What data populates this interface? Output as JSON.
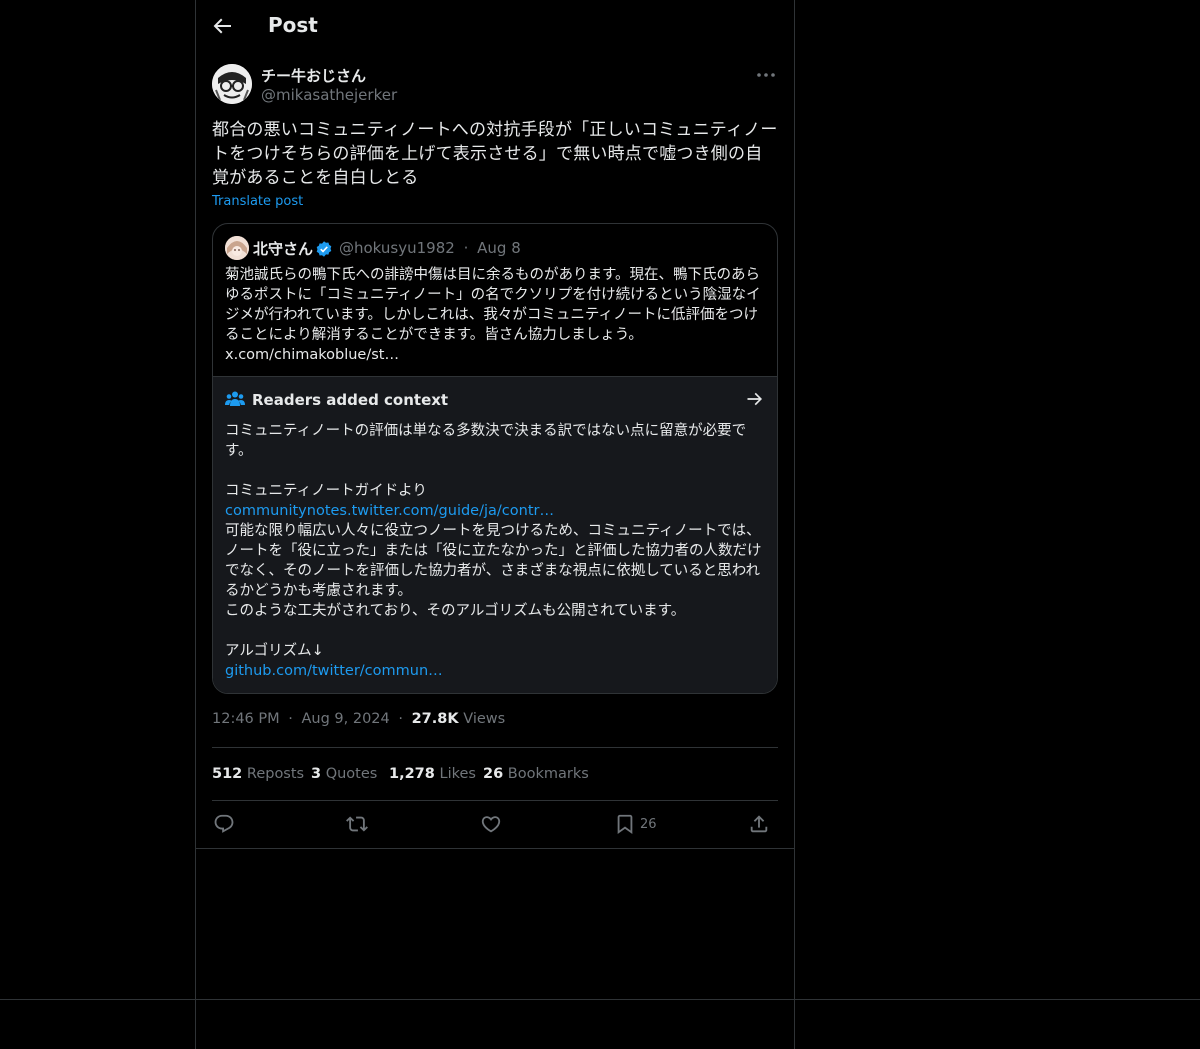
{
  "header": {
    "title": "Post",
    "back_icon": "arrow-left-icon"
  },
  "author": {
    "display_name": "チー牛おじさん",
    "handle": "@mikasathejerker"
  },
  "post": {
    "text": "都合の悪いコミュニティノートへの対抗手段が「正しいコミュニティノートをつけそちらの評価を上げて表示させる」で無い時点で嘘つき側の自覚があることを自白しとる",
    "translate_label": "Translate post"
  },
  "quote": {
    "display_name": "北守さん",
    "verified": true,
    "handle": "@hokusyu1982",
    "separator": "·",
    "date": "Aug 8",
    "text": "菊池誠氏らの鴨下氏への誹謗中傷は目に余るものがあります。現在、鴨下氏のあらゆるポストに「コミュニティノート」の名でクソリプを付け続けるという陰湿なイジメが行われています。しかしこれは、我々がコミュニティノートに低評価をつけることにより解消することができます。皆さん協力しましょう。",
    "link": "x.com/chimakoblue/st…"
  },
  "community_note": {
    "title": "Readers added context",
    "paragraph1": "コミュニティノートの評価は単なる多数決で決まる訳ではない点に留意が必要です。",
    "paragraph2_heading": "コミュニティノートガイドより",
    "link1": "communitynotes.twitter.com/guide/ja/contr…",
    "paragraph3": "可能な限り幅広い人々に役立つノートを見つけるため、コミュニティノートでは、ノートを「役に立った」または「役に立たなかった」と評価した協力者の人数だけでなく、そのノートを評価した協力者が、さまざまな視点に依拠していると思われるかどうかも考慮されます。\nこのような工夫がされており、そのアルゴリズムも公開されています。",
    "paragraph4": "アルゴリズム↓",
    "link2": "github.com/twitter/commun…"
  },
  "meta": {
    "time": "12:46 PM",
    "dot": "·",
    "date": "Aug 9, 2024",
    "views_count": "27.8K",
    "views_label": "Views"
  },
  "stats": {
    "reposts_count": "512",
    "reposts_label": "Reposts",
    "quotes_count": "3",
    "quotes_label": "Quotes",
    "likes_count": "1,278",
    "likes_label": "Likes",
    "bookmarks_count": "26",
    "bookmarks_label": "Bookmarks"
  },
  "actions": {
    "bookmark_count": "26",
    "icons": [
      "reply-icon",
      "repost-icon",
      "like-icon",
      "bookmark-icon",
      "share-icon"
    ]
  },
  "colors": {
    "background": "#000000",
    "text": "#e7e9ea",
    "muted": "#71767b",
    "accent": "#1d9bf0",
    "border": "#2f3336",
    "note_bg": "#16181c"
  }
}
